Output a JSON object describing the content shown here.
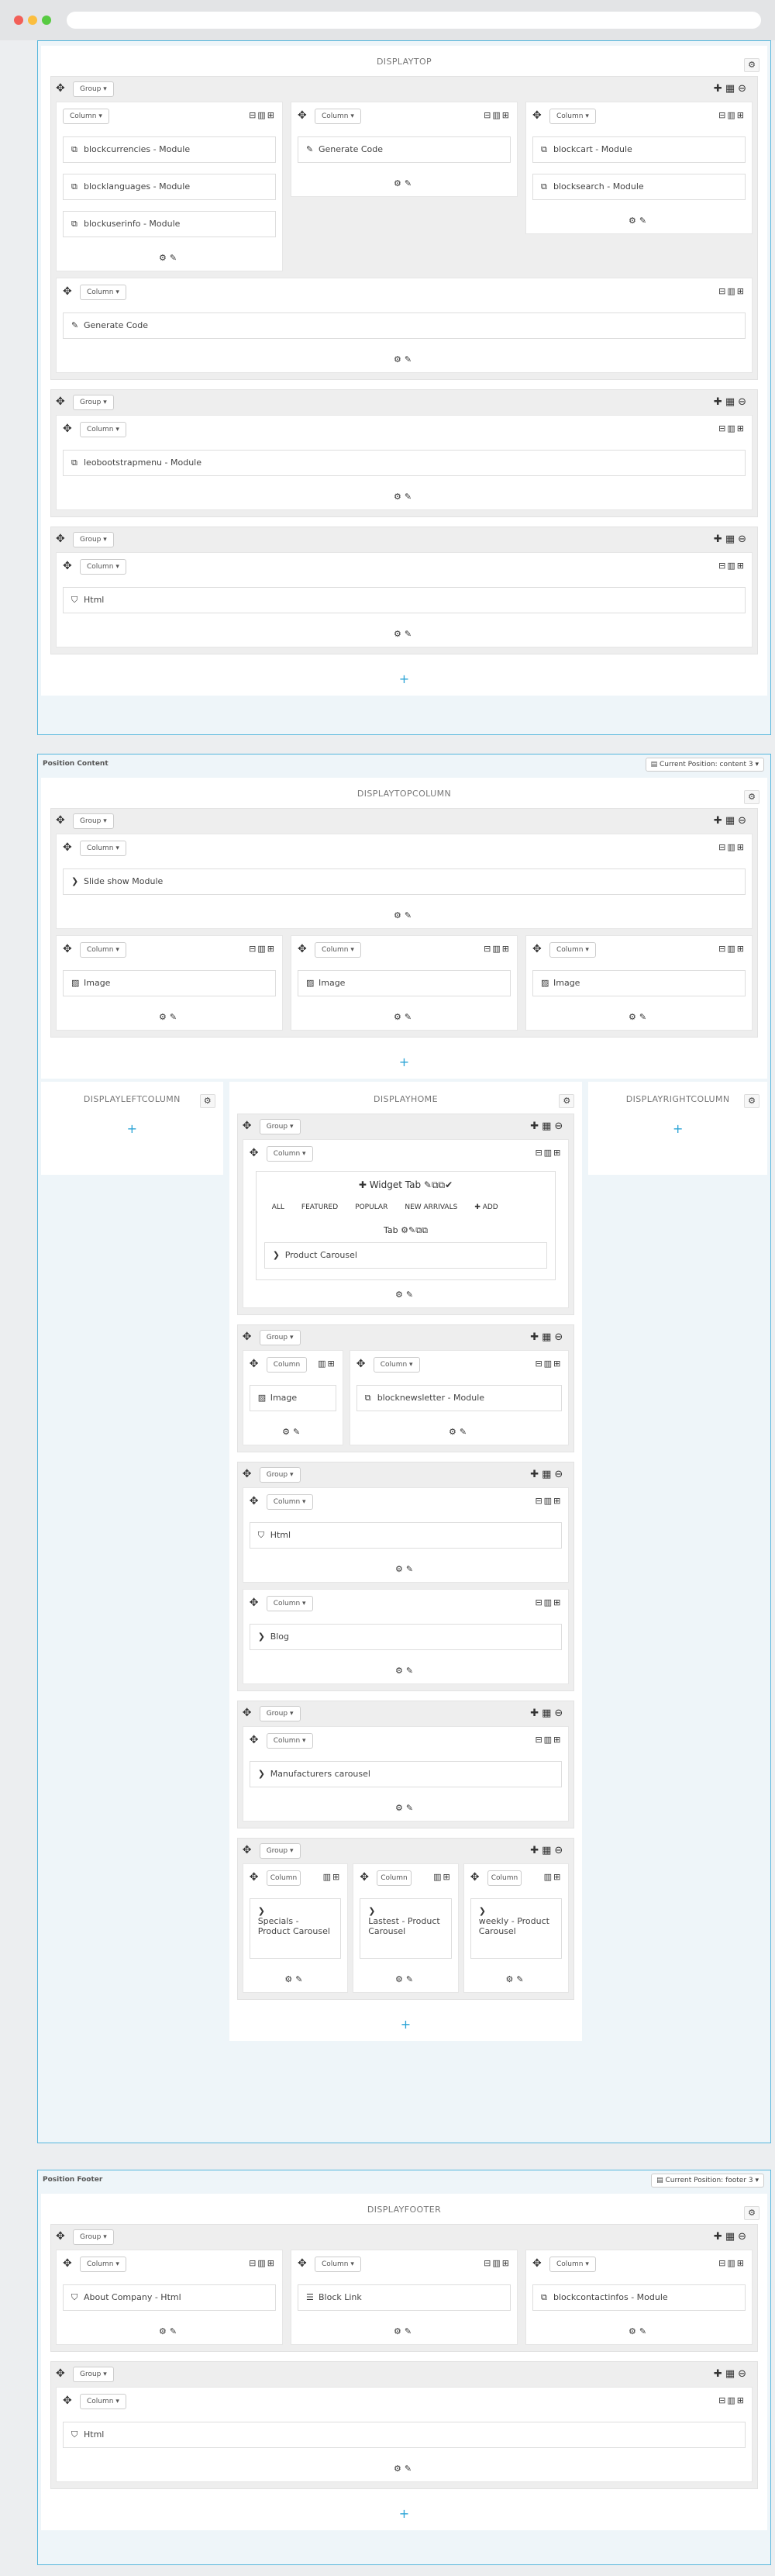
{
  "icons": {
    "move": "move-icon",
    "gear": "gear-icon",
    "edit": "edit-icon",
    "plus": "plus-icon",
    "grid": "grid-icon",
    "close": "close-icon",
    "module": "module-icon",
    "code": "code-icon",
    "image": "image-icon",
    "html": "html5-icon",
    "chevron": "chevron-right-icon",
    "list": "list-icon",
    "copy": "copy-icon",
    "check": "check-icon"
  },
  "colors": {
    "accent": "#2aa3d6",
    "border": "#56b7dd",
    "canvas": "#eceef0"
  },
  "labels": {
    "group": "Group",
    "column": "Column",
    "add": "+"
  },
  "top": {
    "hook": "DISPLAYTOP",
    "g1": {
      "c1": [
        "blockcurrencies - Module",
        "blocklanguages - Module",
        "blockuserinfo - Module"
      ],
      "c2": [
        "Generate Code"
      ],
      "c3": [
        "blockcart - Module",
        "blocksearch - Module"
      ],
      "c4": [
        "Generate Code"
      ]
    },
    "g2": "leobootstrapmenu - Module",
    "g3": "Html"
  },
  "content": {
    "title": "Position Content",
    "select": "Current Position: content 3",
    "hook": "DISPLAYTOPCOLUMN",
    "slideshow": "Slide show Module",
    "images": [
      "Image",
      "Image",
      "Image"
    ],
    "left": "DISPLAYLEFTCOLUMN",
    "home": "DISPLAYHOME",
    "right": "DISPLAYRIGHTCOLUMN",
    "widget_tab": "Widget Tab",
    "tabs": [
      "ALL",
      "FEATURED",
      "POPULAR",
      "NEW ARRIVALS",
      "ADD"
    ],
    "tab_label": "Tab",
    "product_carousel": "Product Carousel",
    "image": "Image",
    "newsletter": "blocknewsletter - Module",
    "html": "Html",
    "blog": "Blog",
    "manufacturers": "Manufacturers carousel",
    "carousels": [
      "Specials - Product Carousel",
      "Lastest - Product Carousel",
      "weekly - Product Carousel"
    ]
  },
  "footer": {
    "title": "Position Footer",
    "select": "Current Position: footer 3",
    "hook": "DISPLAYFOOTER",
    "modules": [
      "About Company - Html",
      "Block Link",
      "blockcontactinfos - Module"
    ],
    "html": "Html"
  }
}
